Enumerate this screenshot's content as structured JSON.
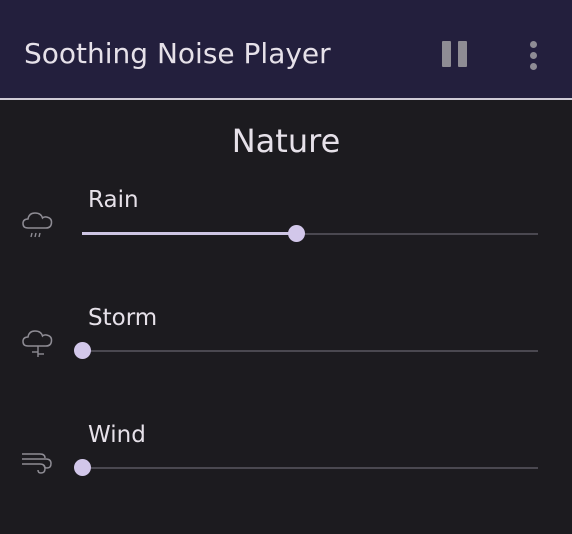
{
  "app": {
    "title": "Soothing Noise Player",
    "colors": {
      "topbar": "#231f3d",
      "background": "#1c1b1f",
      "accent": "#d2c7ea",
      "text": "#e6e1e9",
      "track": "#4a4850"
    }
  },
  "toolbar": {
    "pause_icon": "pause-icon",
    "menu_icon": "more-vert-icon"
  },
  "section": {
    "title": "Nature"
  },
  "sounds": [
    {
      "label": "Rain",
      "icon": "rain-cloud-icon",
      "volume": 0.47
    },
    {
      "label": "Storm",
      "icon": "storm-cloud-icon",
      "volume": 0.0
    },
    {
      "label": "Wind",
      "icon": "wind-icon",
      "volume": 0.0
    }
  ]
}
